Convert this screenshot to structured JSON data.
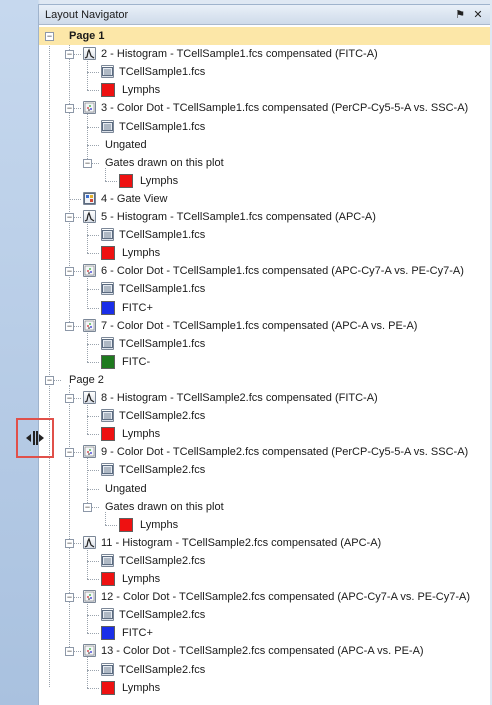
{
  "panel": {
    "title": "Layout Navigator",
    "pin_glyph": "⚑",
    "close_glyph": "✕"
  },
  "tree": [
    {
      "level": 0,
      "text": "Page 1",
      "type": "page",
      "bold": true,
      "highlight": true
    },
    {
      "level": 1,
      "text": "2 - Histogram - TCellSample1.fcs compensated (FITC-A)",
      "type": "plot",
      "icon": "histogram"
    },
    {
      "level": 2,
      "text": "TCellSample1.fcs",
      "type": "file"
    },
    {
      "level": 2,
      "text": "Lymphs",
      "type": "gate",
      "color": "#ee1111"
    },
    {
      "level": 1,
      "text": "3 - Color Dot - TCellSample1.fcs compensated (PerCP-Cy5-5-A vs. SSC-A)",
      "type": "plot",
      "icon": "dot"
    },
    {
      "level": 2,
      "text": "TCellSample1.fcs",
      "type": "file"
    },
    {
      "level": 2,
      "text": "Ungated",
      "type": "text"
    },
    {
      "level": 2,
      "text": "Gates drawn on this plot",
      "type": "folder"
    },
    {
      "level": 3,
      "text": "Lymphs",
      "type": "gate",
      "color": "#ee1111"
    },
    {
      "level": 1,
      "text": "4 - Gate View",
      "type": "gateview"
    },
    {
      "level": 1,
      "text": "5 - Histogram - TCellSample1.fcs compensated (APC-A)",
      "type": "plot",
      "icon": "histogram"
    },
    {
      "level": 2,
      "text": "TCellSample1.fcs",
      "type": "file"
    },
    {
      "level": 2,
      "text": "Lymphs",
      "type": "gate",
      "color": "#ee1111"
    },
    {
      "level": 1,
      "text": "6 - Color Dot - TCellSample1.fcs compensated (APC-Cy7-A vs. PE-Cy7-A)",
      "type": "plot",
      "icon": "dot"
    },
    {
      "level": 2,
      "text": "TCellSample1.fcs",
      "type": "file"
    },
    {
      "level": 2,
      "text": "FITC+",
      "type": "gate",
      "color": "#1a2ee8"
    },
    {
      "level": 1,
      "text": "7 - Color Dot - TCellSample1.fcs compensated (APC-A vs. PE-A)",
      "type": "plot",
      "icon": "dot"
    },
    {
      "level": 2,
      "text": "TCellSample1.fcs",
      "type": "file"
    },
    {
      "level": 2,
      "text": "FITC-",
      "type": "gate",
      "color": "#1f7a1f"
    },
    {
      "level": 0,
      "text": "Page 2",
      "type": "page"
    },
    {
      "level": 1,
      "text": "8 - Histogram - TCellSample2.fcs compensated (FITC-A)",
      "type": "plot",
      "icon": "histogram"
    },
    {
      "level": 2,
      "text": "TCellSample2.fcs",
      "type": "file"
    },
    {
      "level": 2,
      "text": "Lymphs",
      "type": "gate",
      "color": "#ee1111"
    },
    {
      "level": 1,
      "text": "9 - Color Dot - TCellSample2.fcs compensated (PerCP-Cy5-5-A vs. SSC-A)",
      "type": "plot",
      "icon": "dot"
    },
    {
      "level": 2,
      "text": "TCellSample2.fcs",
      "type": "file"
    },
    {
      "level": 2,
      "text": "Ungated",
      "type": "text"
    },
    {
      "level": 2,
      "text": "Gates drawn on this plot",
      "type": "folder"
    },
    {
      "level": 3,
      "text": "Lymphs",
      "type": "gate",
      "color": "#ee1111"
    },
    {
      "level": 1,
      "text": "11 - Histogram - TCellSample2.fcs compensated (APC-A)",
      "type": "plot",
      "icon": "histogram"
    },
    {
      "level": 2,
      "text": "TCellSample2.fcs",
      "type": "file"
    },
    {
      "level": 2,
      "text": "Lymphs",
      "type": "gate",
      "color": "#ee1111"
    },
    {
      "level": 1,
      "text": "12 - Color Dot - TCellSample2.fcs compensated (APC-Cy7-A vs. PE-Cy7-A)",
      "type": "plot",
      "icon": "dot"
    },
    {
      "level": 2,
      "text": "TCellSample2.fcs",
      "type": "file"
    },
    {
      "level": 2,
      "text": "FITC+",
      "type": "gate",
      "color": "#1a2ee8"
    },
    {
      "level": 1,
      "text": "13 - Color Dot - TCellSample2.fcs compensated (APC-A vs. PE-A)",
      "type": "plot",
      "icon": "dot"
    },
    {
      "level": 2,
      "text": "TCellSample2.fcs",
      "type": "file"
    },
    {
      "level": 2,
      "text": "Lymphs",
      "type": "gate",
      "color": "#ee1111"
    }
  ]
}
